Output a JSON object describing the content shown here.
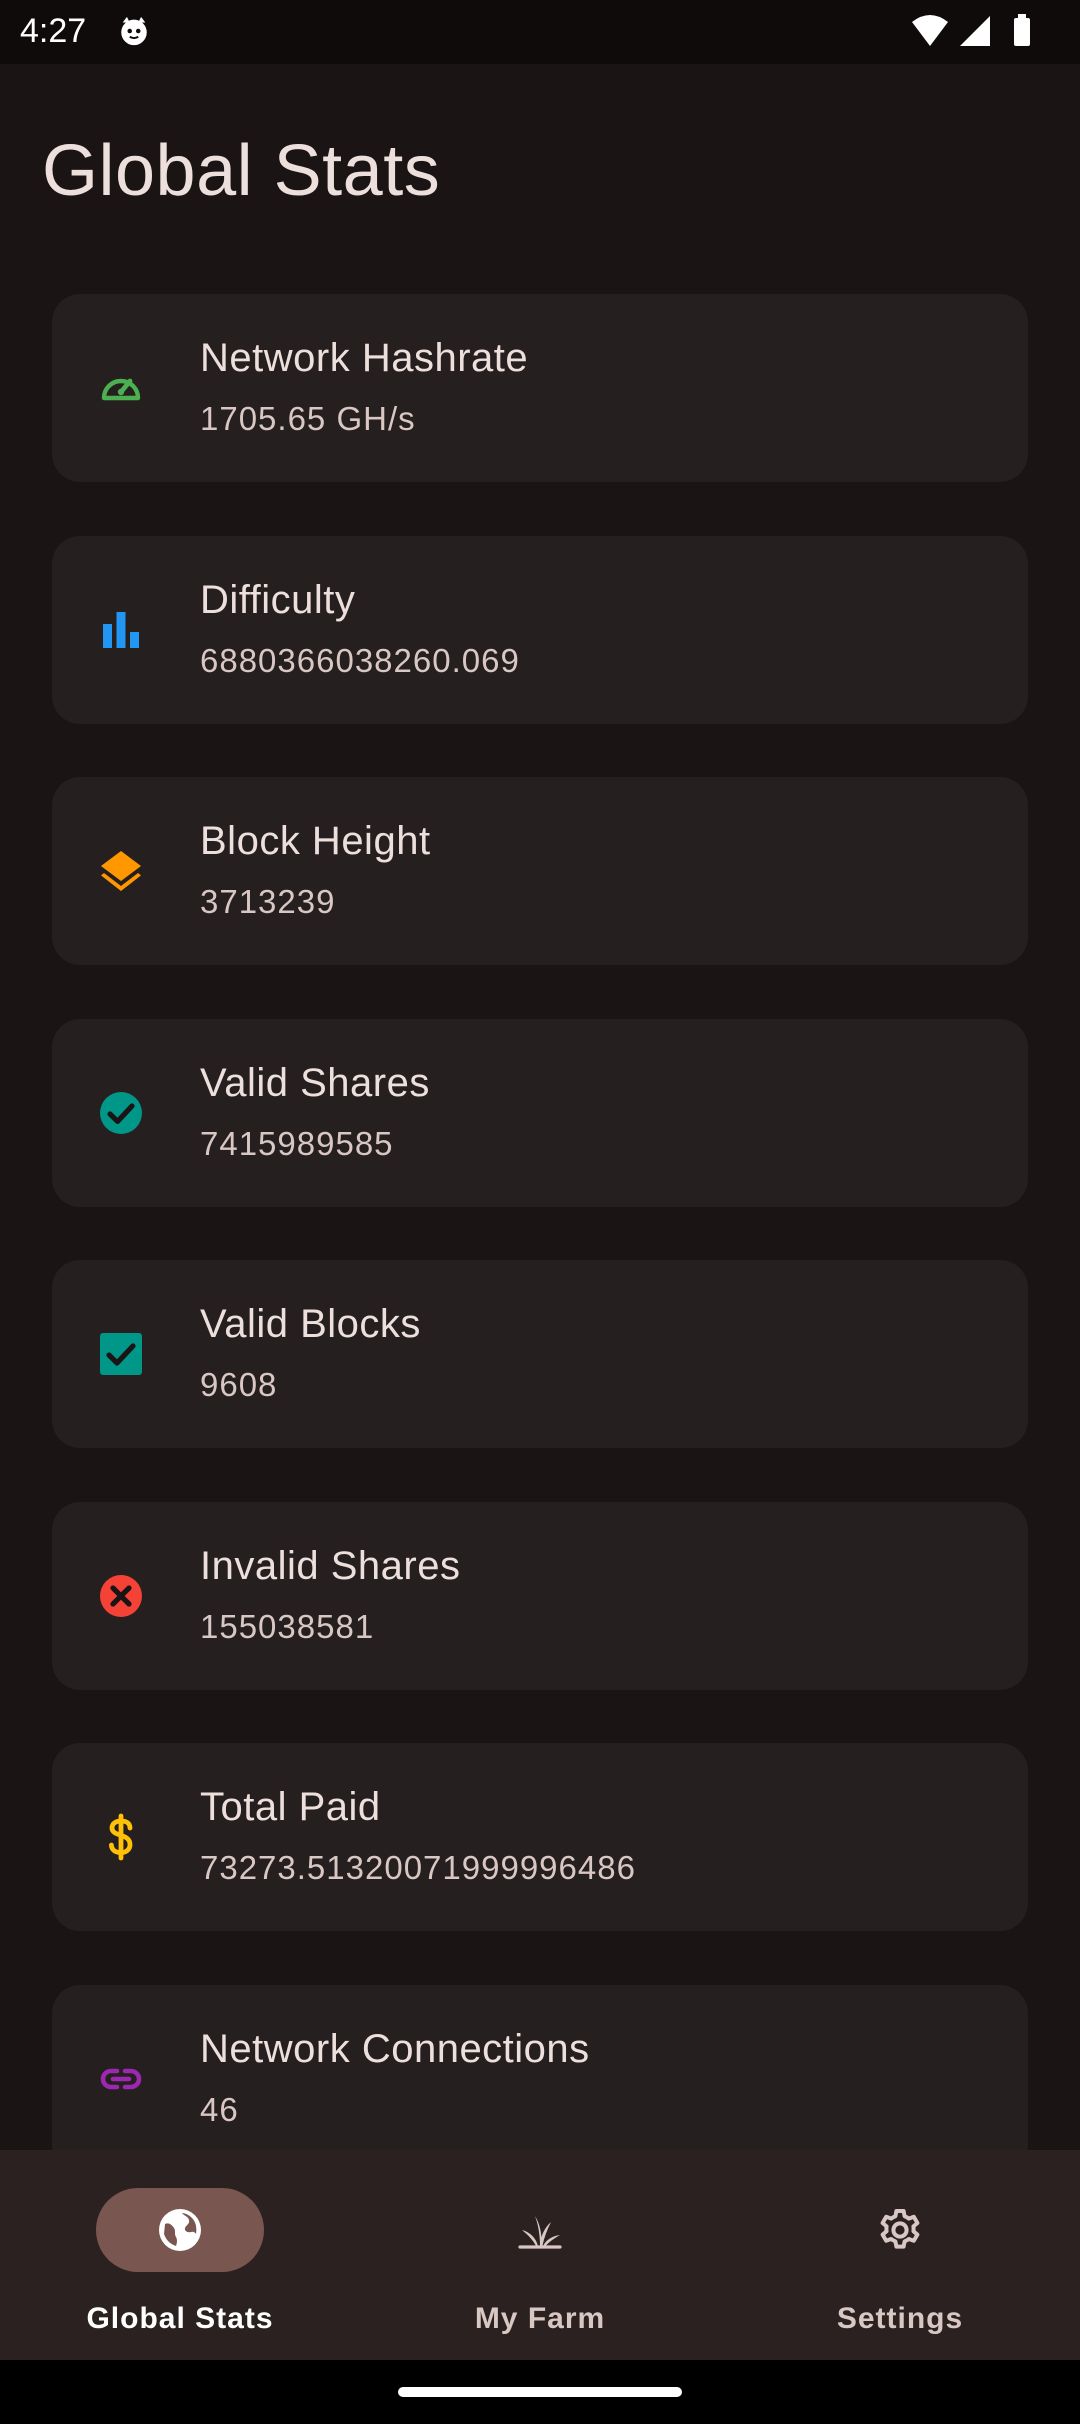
{
  "status_bar": {
    "time": "4:27"
  },
  "page": {
    "title": "Global Stats"
  },
  "stats": [
    {
      "title": "Network Hashrate",
      "value": "1705.65 GH/s",
      "icon": "speedometer-icon",
      "color": "#4caf50"
    },
    {
      "title": "Difficulty",
      "value": "6880366038260.069",
      "icon": "bar-chart-icon",
      "color": "#2196f3"
    },
    {
      "title": "Block Height",
      "value": "3713239",
      "icon": "layers-icon",
      "color": "#ff9800"
    },
    {
      "title": "Valid Shares",
      "value": "7415989585",
      "icon": "check-circle-icon",
      "color": "#009688"
    },
    {
      "title": "Valid Blocks",
      "value": "9608",
      "icon": "check-box-icon",
      "color": "#009688"
    },
    {
      "title": "Invalid Shares",
      "value": "155038581",
      "icon": "cancel-circle-icon",
      "color": "#f44336"
    },
    {
      "title": "Total Paid",
      "value": "73273.51320071999996486",
      "icon": "dollar-icon",
      "color": "#ffc107"
    },
    {
      "title": "Network Connections",
      "value": "46",
      "icon": "link-icon",
      "color": "#9c27b0"
    }
  ],
  "nav": {
    "items": [
      {
        "label": "Global Stats",
        "icon": "globe-icon",
        "active": true
      },
      {
        "label": "My Farm",
        "icon": "sprout-icon",
        "active": false
      },
      {
        "label": "Settings",
        "icon": "gear-icon",
        "active": false
      }
    ]
  }
}
